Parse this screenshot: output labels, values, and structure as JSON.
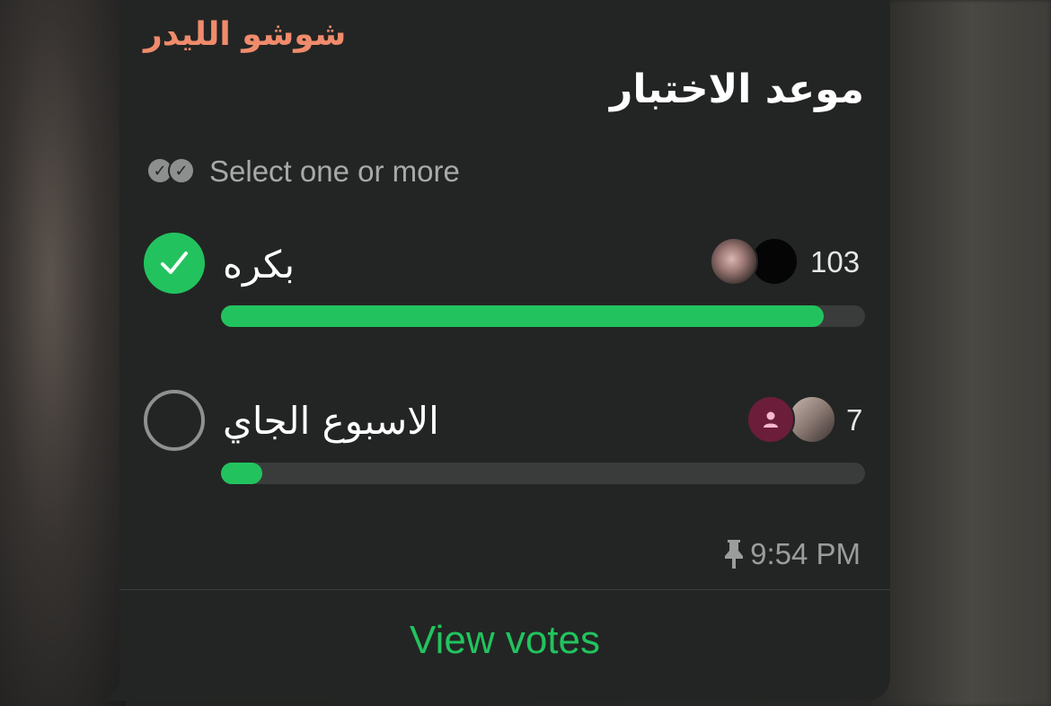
{
  "message": {
    "sender": "شوشو الليدر",
    "poll_question": "موعد الاختبار",
    "hint": "Select one or more",
    "time": "9:54 PM",
    "pinned": true
  },
  "options": [
    {
      "label": "بكره",
      "votes": "103",
      "selected": true,
      "fill_percent": 93.6
    },
    {
      "label": "الاسبوع الجاي",
      "votes": "7",
      "selected": false,
      "fill_percent": 6.4
    }
  ],
  "actions": {
    "view_votes": "View votes"
  },
  "colors": {
    "accent": "#22c35e",
    "sender": "#f08b6c",
    "bubble": "#232524"
  }
}
